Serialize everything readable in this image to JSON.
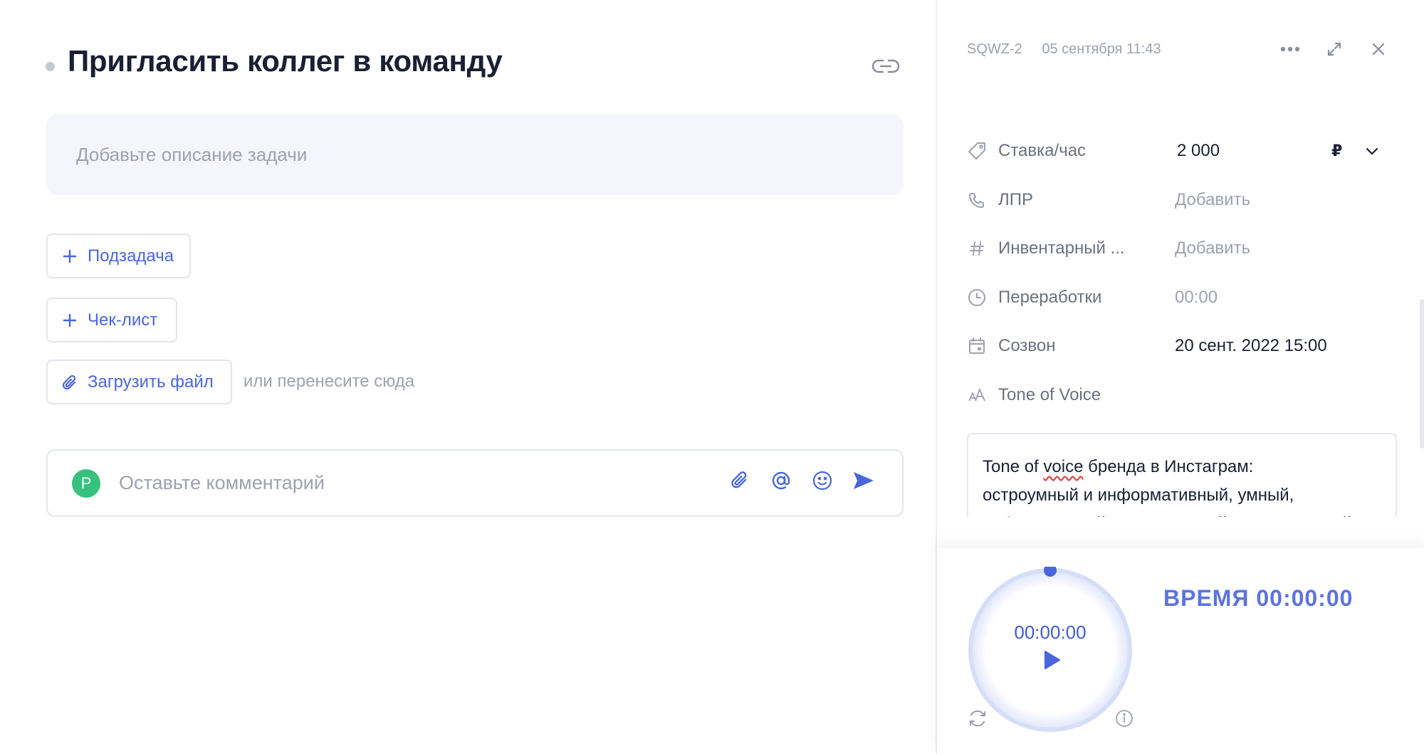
{
  "task": {
    "title": "Пригласить коллег в команду",
    "description_placeholder": "Добавьте описание задачи",
    "subtask_label": "Подзадача",
    "checklist_label": "Чек-лист",
    "upload_label": "Загрузить файл",
    "drop_hint": "или перенесите сюда",
    "comment_placeholder": "Оставьте комментарий",
    "avatar_initial": "P"
  },
  "panel": {
    "task_id": "SQWZ-2",
    "created": "05 сентября 11:43",
    "fields": [
      {
        "icon": "tag-icon",
        "label": "Ставка/час",
        "value": "2 000",
        "currency": "₽"
      },
      {
        "icon": "phone-icon",
        "label": "ЛПР",
        "value": "Добавить"
      },
      {
        "icon": "hash-icon",
        "label": "Инвентарный ...",
        "value": "Добавить"
      },
      {
        "icon": "clock-icon",
        "label": "Переработки",
        "value": "00:00"
      },
      {
        "icon": "calendar-icon",
        "label": "Созвон",
        "value": "20 сент. 2022 15:00"
      },
      {
        "icon": "text-size-icon",
        "label": "Tone of Voice",
        "value": ""
      }
    ],
    "tone_text_line1_a": "Tone of ",
    "tone_text_line1_b": "voice",
    "tone_text_line1_c": " бренда в Инстаграм:",
    "tone_text_line2": "остроумный и информативный, умный,",
    "tone_text_line3": "неформальный и откровенный, уважительный"
  },
  "timer": {
    "ring_time": "00:00:00",
    "label": "ВРЕМЯ 00:00:00"
  },
  "colors": {
    "accent": "#4a66db",
    "avatar": "#36c17f",
    "description_bg": "#f4f5fd"
  }
}
